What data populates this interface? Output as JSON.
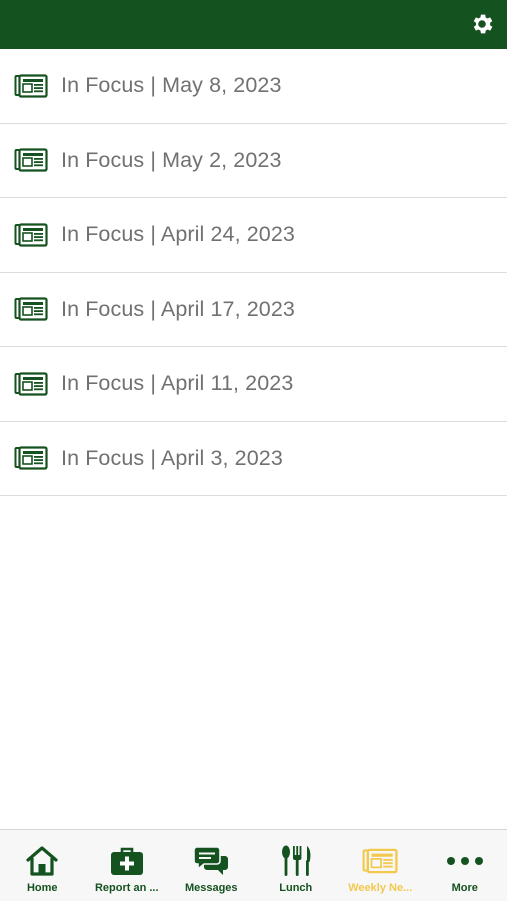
{
  "colors": {
    "brand": "#14521f",
    "active_tab": "#f2c94c",
    "text": "#717171"
  },
  "header": {
    "settings_icon": "gear-icon"
  },
  "newsletters": [
    {
      "label": "In Focus | May 8, 2023",
      "icon": "newspaper-icon"
    },
    {
      "label": "In Focus | May 2, 2023",
      "icon": "newspaper-icon"
    },
    {
      "label": "In Focus | April 24, 2023",
      "icon": "newspaper-icon"
    },
    {
      "label": "In Focus | April 17, 2023",
      "icon": "newspaper-icon"
    },
    {
      "label": "In Focus | April 11, 2023",
      "icon": "newspaper-icon"
    },
    {
      "label": "In Focus | April 3, 2023",
      "icon": "newspaper-icon"
    }
  ],
  "tabbar": {
    "tabs": [
      {
        "label": "Home",
        "icon": "home-icon",
        "active": false
      },
      {
        "label": "Report an ...",
        "icon": "medical-kit-icon",
        "active": false
      },
      {
        "label": "Messages",
        "icon": "chat-bubbles-icon",
        "active": false
      },
      {
        "label": "Lunch",
        "icon": "utensils-icon",
        "active": false
      },
      {
        "label": "Weekly Ne...",
        "icon": "newspaper-icon",
        "active": true
      },
      {
        "label": "More",
        "icon": "more-dots-icon",
        "active": false
      }
    ]
  }
}
